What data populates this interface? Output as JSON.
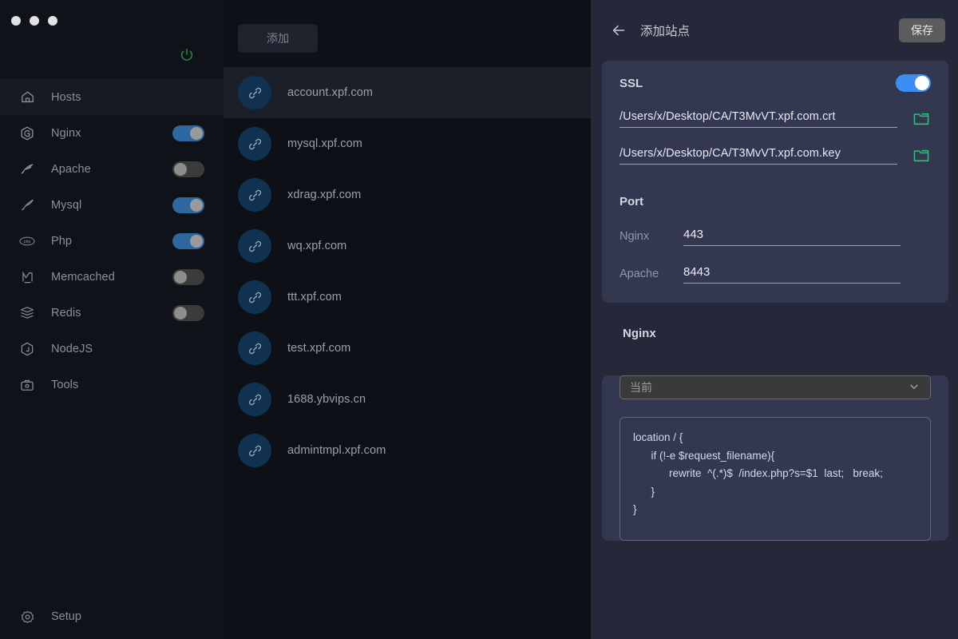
{
  "window": {
    "traffic_lights": [
      "close",
      "minimize",
      "maximize"
    ]
  },
  "sidebar": {
    "power_icon": "power-icon",
    "items": [
      {
        "label": "Hosts",
        "icon": "home-icon",
        "active": true,
        "toggle": null
      },
      {
        "label": "Nginx",
        "icon": "nginx-icon",
        "active": false,
        "toggle": "on"
      },
      {
        "label": "Apache",
        "icon": "apache-icon",
        "active": false,
        "toggle": "off"
      },
      {
        "label": "Mysql",
        "icon": "mysql-icon",
        "active": false,
        "toggle": "on"
      },
      {
        "label": "Php",
        "icon": "php-icon",
        "active": false,
        "toggle": "on"
      },
      {
        "label": "Memcached",
        "icon": "memcached-icon",
        "active": false,
        "toggle": "off"
      },
      {
        "label": "Redis",
        "icon": "redis-icon",
        "active": false,
        "toggle": "off"
      },
      {
        "label": "NodeJS",
        "icon": "nodejs-icon",
        "active": false,
        "toggle": null
      },
      {
        "label": "Tools",
        "icon": "tools-icon",
        "active": false,
        "toggle": null
      }
    ],
    "setup": {
      "label": "Setup",
      "icon": "gear-icon"
    }
  },
  "host_list": {
    "add_button_label": "添加",
    "item_icon": "link-icon",
    "items": [
      {
        "name": "account.xpf.com",
        "selected": true
      },
      {
        "name": "mysql.xpf.com",
        "selected": false
      },
      {
        "name": "xdrag.xpf.com",
        "selected": false
      },
      {
        "name": "wq.xpf.com",
        "selected": false
      },
      {
        "name": "ttt.xpf.com",
        "selected": false
      },
      {
        "name": "test.xpf.com",
        "selected": false
      },
      {
        "name": "1688.ybvips.cn",
        "selected": false
      },
      {
        "name": "admintmpl.xpf.com",
        "selected": false
      }
    ]
  },
  "detail": {
    "back_icon": "arrow-left-icon",
    "title": "添加站点",
    "save_label": "保存",
    "ssl": {
      "label": "SSL",
      "enabled": true,
      "cert_path": "/Users/x/Desktop/CA/T3MvVT.xpf.com.crt",
      "key_path": "/Users/x/Desktop/CA/T3MvVT.xpf.com.key",
      "browse_icon": "folder-icon"
    },
    "port": {
      "title": "Port",
      "nginx_label": "Nginx",
      "nginx_value": "443",
      "apache_label": "Apache",
      "apache_value": "8443"
    },
    "nginx": {
      "heading": "Nginx",
      "select_value": "当前",
      "select_icon": "chevron-down-icon",
      "config": "location / {\n      if (!-e $request_filename){\n            rewrite  ^(.*)$  /index.php?s=$1  last;   break;\n      }\n}"
    }
  },
  "colors": {
    "sidebar_bg": "#0f1219",
    "list_bg": "#0d1117",
    "detail_bg": "#242839",
    "card_bg": "#333750",
    "toggle_on": "#2e66a0",
    "toggle_off": "#3b3b3b",
    "ssl_toggle_on": "#3c8ef5",
    "folder_green": "#22c96e",
    "power_green": "#2c8a3c",
    "link_circle": "#103250"
  }
}
